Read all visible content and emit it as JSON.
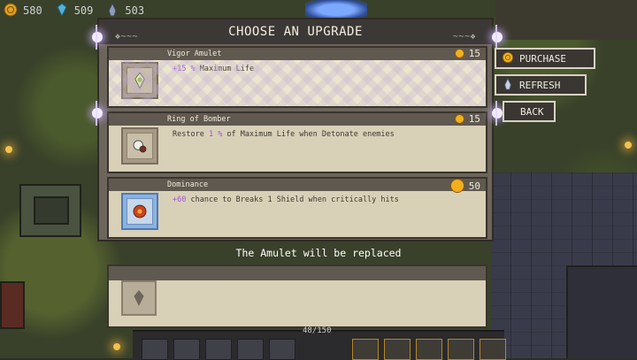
{
  "resources": {
    "gold": "580",
    "gems": "509",
    "souls": "503"
  },
  "dialog": {
    "title": "CHOOSE AN UPGRADE"
  },
  "offers": [
    {
      "name": "Vigor Amulet",
      "price": "15",
      "desc_value": "+15 %",
      "desc_rest": " Maximum Life",
      "icon": "amulet-icon",
      "selected": true
    },
    {
      "name": "Ring of Bomber",
      "price": "15",
      "desc_prefix": "Restore ",
      "desc_value": "1 %",
      "desc_rest": " of Maximum Life when Detonate enemies",
      "icon": "ring-icon"
    },
    {
      "name": "Dominance",
      "price": "50",
      "desc_value": "+60",
      "desc_rest": " chance to Breaks 1 Shield when critically hits",
      "icon": "dominance-relic-icon"
    }
  ],
  "replace_message": "The Amulet will be replaced",
  "buttons": {
    "purchase": "PURCHASE",
    "refresh": "REFRESH",
    "back": "BACK"
  },
  "hud": {
    "hp": "48/150"
  },
  "colors": {
    "highlight": "#9b5bd1",
    "coin": "#f2b01e",
    "panel": "#d9d0b8",
    "header": "#3c3835"
  }
}
